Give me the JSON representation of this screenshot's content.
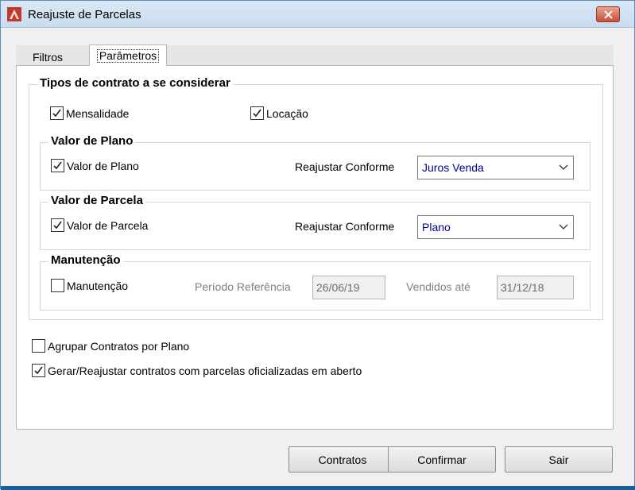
{
  "window": {
    "title": "Reajuste de Parcelas",
    "icon": "app-red-logo-icon",
    "close_icon": "close-icon"
  },
  "tabs": [
    {
      "label": "Filtros",
      "active": false
    },
    {
      "label": "Parâmetros",
      "active": true
    }
  ],
  "tipos_contrato": {
    "title": "Tipos de contrato a se considerar",
    "mensalidade": {
      "label": "Mensalidade",
      "checked": true
    },
    "locacao": {
      "label": "Locação",
      "checked": true
    }
  },
  "valor_plano": {
    "title": "Valor de Plano",
    "checkbox": {
      "label": "Valor de Plano",
      "checked": true
    },
    "reajustar_label": "Reajustar Conforme",
    "select_value": "Juros Venda"
  },
  "valor_parcela": {
    "title": "Valor de Parcela",
    "checkbox": {
      "label": "Valor de Parcela",
      "checked": true
    },
    "reajustar_label": "Reajustar Conforme",
    "select_value": "Plano"
  },
  "manutencao": {
    "title": "Manutenção",
    "checkbox": {
      "label": "Manutenção",
      "checked": false
    },
    "periodo_label": "Período Referência",
    "periodo_value": "26/06/19",
    "vendidos_label": "Vendidos até",
    "vendidos_value": "31/12/18"
  },
  "options": {
    "agrupar": {
      "label": "Agrupar Contratos por Plano",
      "checked": false
    },
    "gerar": {
      "label": "Gerar/Reajustar contratos com parcelas oficializadas em aberto",
      "checked": true
    }
  },
  "buttons": {
    "contratos": "Contratos",
    "confirmar": "Confirmar",
    "sair": "Sair"
  },
  "colors": {
    "accent": "#00008b",
    "close": "#c74f38",
    "titlebar": "#c9dcef"
  }
}
